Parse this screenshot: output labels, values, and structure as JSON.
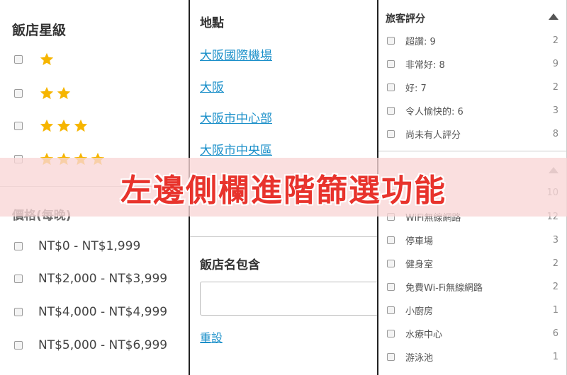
{
  "star_filter": {
    "title": "飯店星級",
    "star_color": "#f6b500",
    "options": [
      {
        "stars": 1
      },
      {
        "stars": 2
      },
      {
        "stars": 3
      },
      {
        "stars": 4
      }
    ]
  },
  "price_filter": {
    "title": "價格(每晚)",
    "options": [
      "NT$0 - NT$1,999",
      "NT$2,000 - NT$3,999",
      "NT$4,000 - NT$4,999",
      "NT$5,000 - NT$6,999"
    ]
  },
  "location_filter": {
    "title": "地點",
    "links": [
      "大阪國際機場",
      "大阪",
      "大阪市中心部",
      "大阪市中央區"
    ]
  },
  "name_filter": {
    "title": "飯店名包含",
    "input_value": "",
    "reset_label": "重設"
  },
  "rating_filter": {
    "title": "旅客評分",
    "options": [
      {
        "label": "超讚: 9",
        "count": "2"
      },
      {
        "label": "非常好: 8",
        "count": "9"
      },
      {
        "label": "好: 7",
        "count": "2"
      },
      {
        "label": "令人愉快的: 6",
        "count": "3"
      },
      {
        "label": "尚未有人評分",
        "count": "8"
      }
    ]
  },
  "amenity_filter": {
    "options": [
      {
        "label": "",
        "count": "10"
      },
      {
        "label": "WiFi無線網路",
        "count": "12"
      },
      {
        "label": "停車場",
        "count": "3"
      },
      {
        "label": "健身室",
        "count": "2"
      },
      {
        "label": "免費Wi-Fi無線網路",
        "count": "2"
      },
      {
        "label": "小廚房",
        "count": "1"
      },
      {
        "label": "水療中心",
        "count": "6"
      },
      {
        "label": "游泳池",
        "count": "1"
      }
    ]
  },
  "banner": {
    "text": "左邊側欄進階篩選功能"
  }
}
